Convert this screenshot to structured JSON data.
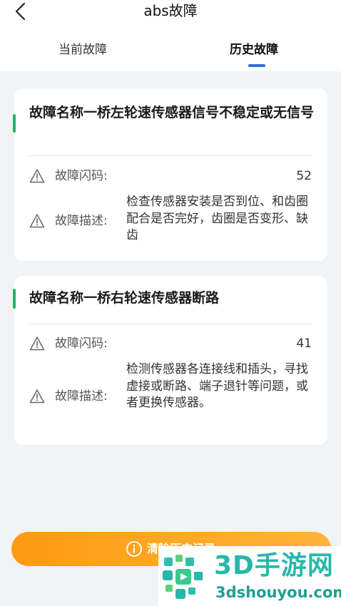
{
  "header": {
    "title": "abs故障",
    "back_icon": "chevron-left-icon"
  },
  "tabs": [
    {
      "label": "当前故障",
      "active": false
    },
    {
      "label": "历史故障",
      "active": true
    }
  ],
  "faults": [
    {
      "name": "故障名称一桥左轮速传感器信号不稳定或无信号",
      "code_label": "故障闪码:",
      "code_value": "52",
      "desc_label": "故障描述:",
      "desc_value": "检查传感器安装是否到位、和齿圈配合是否完好，齿圈是否变形、缺齿"
    },
    {
      "name": "故障名称一桥右轮速传感器断路",
      "code_label": "故障闪码:",
      "code_value": "41",
      "desc_label": "故障描述:",
      "desc_value": "检测传感器各连接线和插头，寻找虚接或断路、端子退针等问题，或者更换传感器。"
    }
  ],
  "clear_button": {
    "label": "清除历史记录",
    "icon": "info-circle-icon"
  },
  "watermark": {
    "name": "3D手游网",
    "url": "3dshouyou.com"
  },
  "colors": {
    "accent_green": "#28b463",
    "tab_indicator": "#2f6fd8",
    "button_orange": "#ffa925",
    "watermark_teal": "#26b8a8"
  }
}
